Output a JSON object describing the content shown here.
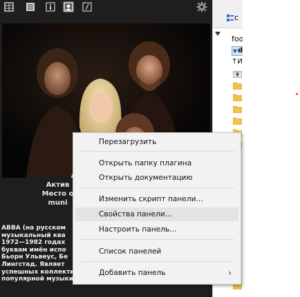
{
  "panel_toolbar": {
    "buttons": [
      {
        "icon": "grid-view-icon"
      },
      {
        "icon": "list-view-icon"
      },
      {
        "icon": "info-icon"
      },
      {
        "icon": "artist-photo-icon"
      },
      {
        "icon": "edit-icon"
      }
    ],
    "settings_icon": "gear-icon"
  },
  "artist_info": {
    "lines": [
      "Актив",
      "Место о",
      "muni"
    ]
  },
  "biography": {
    "lines": [
      "ABBA (на русском",
      "музыкальный ква",
      "1972—1982 годах",
      "буквам имён испо",
      "Бьорн Ульвеус, Бе",
      "Лингстад. Являет",
      "успешных коллективов за всю историю",
      "популярной музыки и самым успешным из числа"
    ]
  },
  "file_panel": {
    "tab_label": "c",
    "path_label": "foo",
    "drive_label": "d:",
    "column_header": "↑Им",
    "rows": [
      {
        "icon": "up-folder-icon",
        "text": "["
      },
      {
        "icon": "folder-icon",
        "text": "["
      },
      {
        "icon": "folder-icon",
        "text": "["
      },
      {
        "icon": "folder-icon",
        "text": "["
      },
      {
        "icon": "folder-icon",
        "text": "["
      },
      {
        "icon": "folder-icon",
        "text": "["
      },
      {
        "icon": "folder-icon",
        "text": "["
      },
      {
        "icon": "folder-icon",
        "text": "["
      }
    ],
    "file_rows": [
      "[",
      "[",
      "[",
      "[",
      "[",
      "[",
      "[",
      "[",
      "[",
      "[",
      "[",
      "[",
      "["
    ]
  },
  "context_menu": {
    "items": [
      {
        "label": "Перезагрузить"
      },
      {
        "label": "Открыть папку плагина"
      },
      {
        "label": "Открыть документацию"
      },
      {
        "label": "Изменить скрипт панели..."
      },
      {
        "label": "Свойства панели..."
      },
      {
        "label": "Настроить панель..."
      },
      {
        "label": "Список панелей"
      },
      {
        "label": "Добавить панель",
        "submenu": true
      }
    ],
    "highlighted_item": "Свойства панели..."
  },
  "colors": {
    "panel_background": "#1e1e1e",
    "menu_background": "#f2f2f2",
    "menu_hover": "#e3e3e3",
    "folder_yellow": "#f0c24b",
    "link_blue": "#1d4fc4"
  }
}
